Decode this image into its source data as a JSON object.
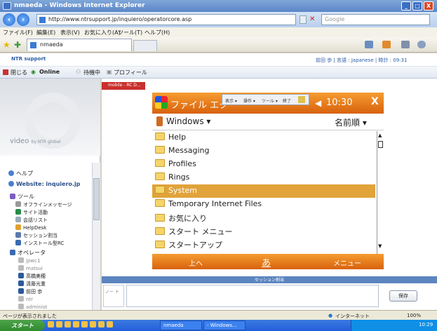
{
  "window": {
    "title": "nmaeda - Windows Internet Explorer",
    "controls": [
      "_",
      "□",
      "X"
    ]
  },
  "address": {
    "url": "http://www.ntrsupport.jp/inquiero/operatorcore.asp",
    "search_placeholder": "Google"
  },
  "menu": {
    "items": [
      "ファイル(F)",
      "編集(E)",
      "表示(V)",
      "お気に入り(A)",
      "ツール(T)",
      "ヘルプ(H)"
    ]
  },
  "tab": {
    "label": "nmaeda"
  },
  "page_header": {
    "logo": "NTR support",
    "user_info": "前田 歩 | 言語 : Japanese | 時計 : 09:31"
  },
  "toolbar": {
    "close": "閉じる",
    "online": "Online",
    "waiting": "待機中",
    "profile": "プロフィール"
  },
  "sidebar": {
    "brand": "video",
    "brand_small": "by NTR global",
    "items": [
      {
        "label": "ヘルプ"
      },
      {
        "label": "Website: inquiero.jp"
      },
      {
        "label": "ツール"
      },
      {
        "label": "オフラインメッセージ"
      },
      {
        "label": "サイト活動"
      },
      {
        "label": "会話リスト"
      },
      {
        "label": "HelpDesk"
      },
      {
        "label": "セッション割当"
      },
      {
        "label": "インストール型RC"
      },
      {
        "label": "オペレータ"
      },
      {
        "label": "jpwc1"
      },
      {
        "label": "matsui"
      },
      {
        "label": "高橋美穂"
      },
      {
        "label": "清藤光重"
      },
      {
        "label": "前田 歩"
      },
      {
        "label": "ntr"
      },
      {
        "label": "administ"
      }
    ]
  },
  "popup": {
    "label": "mobile - RC D..."
  },
  "device": {
    "title": "ファイル エク",
    "time": "10:30",
    "close": "X",
    "overlay_menu": [
      "表示 ▾",
      "操作 ▾",
      "ツール ▾",
      "終了"
    ],
    "location": "Windows ▾",
    "sort": "名前順 ▾",
    "files": [
      "Help",
      "Messaging",
      "Profiles",
      "Rings",
      "System",
      "Temporary Internet Files",
      "お気に入り",
      "スタート メニュー",
      "スタートアップ"
    ],
    "selected_file": "System",
    "softkey_left": "上へ",
    "softkey_middle": "あ",
    "softkey_right": "メニュー"
  },
  "session": {
    "header": "セッション割当",
    "left_text": "ノー\nト",
    "save_button": "保存"
  },
  "statusbar": {
    "message": "ページが表示されました",
    "zone": "インターネット",
    "zoom": "100%"
  },
  "taskbar": {
    "start": "スタート",
    "task1": "nmaeda",
    "task2": "- Windows...",
    "clock": "10:29"
  }
}
